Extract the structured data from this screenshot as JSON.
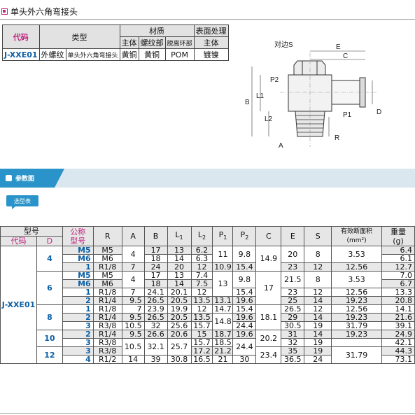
{
  "title": "单头外六角弯接头",
  "product_table": {
    "headers": {
      "code": "代码",
      "type": "类型",
      "material": "材质",
      "surface": "表面处理",
      "body": "主体",
      "thread": "螺纹部",
      "release": "脱离环部",
      "surface_body": "主体"
    },
    "row": {
      "code": "J-XXE01",
      "type1": "外螺纹",
      "type2": "单头外六角弯接头",
      "body": "黄铜",
      "thread": "黄铜",
      "release": "POM",
      "surface": "镀镍"
    }
  },
  "diagram": {
    "hex_label": "对边S",
    "labels": [
      "E",
      "C",
      "P2",
      "L1",
      "B",
      "L2",
      "P1",
      "D",
      "A",
      "R"
    ]
  },
  "section_tab": "参数图",
  "select_button": "选型表",
  "param_table": {
    "headers": {
      "model": "型号",
      "code": "代码",
      "d": "D",
      "nominal_1": "公称",
      "nominal_2": "型号",
      "r": "R",
      "a": "A",
      "b": "B",
      "l1": "L",
      "l1_sub": "1",
      "l2": "L",
      "l2_sub": "2",
      "p1": "P",
      "p1_sub": "1",
      "p2": "P",
      "p2_sub": "2",
      "c": "C",
      "e": "E",
      "s": "S",
      "area_1": "有效断面积",
      "area_2": "(mm²)",
      "weight_1": "重量",
      "weight_2": "(g)"
    },
    "code": "J-XXE01",
    "d_values": [
      "4",
      "6",
      "8",
      "10",
      "12"
    ],
    "rows": [
      {
        "nom": "M5",
        "r": "M5",
        "a": "4",
        "b": "17",
        "l1": "13",
        "l2": "6.2",
        "p1": "11",
        "p2": "9.8",
        "c": "14.9",
        "e": "20",
        "s": "8",
        "area": "3.53",
        "w": "6.4"
      },
      {
        "nom": "M6",
        "r": "M6",
        "b": "18",
        "l1": "14",
        "l2": "6.3",
        "w": "6.1"
      },
      {
        "nom": "1",
        "r": "R1/8",
        "a": "7",
        "b": "24",
        "l1": "20",
        "l2": "12",
        "p1": "10.9",
        "p2": "15.4",
        "e": "23",
        "s": "12",
        "area": "12.56",
        "w": "12.7"
      },
      {
        "nom": "M5",
        "r": "M5",
        "a": "4",
        "b": "17",
        "l1": "13",
        "l2": "7.4",
        "p1": "13",
        "p2": "9.8",
        "c": "17",
        "e": "21.5",
        "s": "8",
        "area": "3.53",
        "w": "7.0"
      },
      {
        "nom": "M6",
        "r": "M6",
        "b": "18",
        "l1": "14",
        "l2": "7.5",
        "w": "6.7"
      },
      {
        "nom": "1",
        "r": "R1/8",
        "a": "7",
        "b": "24.1",
        "l1": "20.1",
        "l2": "12",
        "p2": "15.4",
        "e": "23",
        "s": "12",
        "area": "12.56",
        "w": "13.3"
      },
      {
        "nom": "2",
        "r": "R1/4",
        "a": "9.5",
        "b": "26.5",
        "l1": "20.5",
        "l2": "13.5",
        "p1": "13.1",
        "p2": "19.6",
        "e": "25",
        "s": "14",
        "area": "19.23",
        "w": "20.8"
      },
      {
        "nom": "1",
        "r": "R1/8",
        "a": "7",
        "b": "23.9",
        "l1": "19.9",
        "l2": "12",
        "p1": "14.7",
        "p2": "15.4",
        "c": "18.1",
        "e": "26.5",
        "s": "12",
        "area": "12.56",
        "w": "14.1"
      },
      {
        "nom": "2",
        "r": "R1/4",
        "a": "9.5",
        "b": "26.5",
        "l1": "20.5",
        "l2": "13.5",
        "p1": "14.8",
        "p2": "19.6",
        "e": "29",
        "s": "14",
        "area": "19.23",
        "w": "21.6"
      },
      {
        "nom": "3",
        "r": "R3/8",
        "a": "10.5",
        "b": "32",
        "l1": "25.6",
        "l2": "15.7",
        "p2": "24.4",
        "e": "30.5",
        "s": "19",
        "area": "31.79",
        "w": "39.1"
      },
      {
        "nom": "2",
        "r": "R1/4",
        "a": "9.5",
        "b": "26.6",
        "l1": "20.6",
        "l2": "15",
        "p1": "18.7",
        "p2": "19.6",
        "c": "20.2",
        "e": "31",
        "s": "14",
        "area": "19.23",
        "w": "24.9"
      },
      {
        "nom": "3",
        "r": "R3/8",
        "a": "10.5",
        "b": "32.1",
        "l1": "25.7",
        "l2": "15.7",
        "p1": "18.5",
        "p2": "24.4",
        "e": "32",
        "s": "19",
        "w": "42.1"
      },
      {
        "nom": "3",
        "r": "R3/8",
        "l2": "17.2",
        "p1": "21.2",
        "c": "23.4",
        "e": "35",
        "s": "19",
        "area": "31.79",
        "w": "44.3"
      },
      {
        "nom": "4",
        "r": "R1/2",
        "a": "14",
        "b": "39",
        "l1": "30.8",
        "l2": "16.5",
        "p1": "21",
        "p2": "30",
        "e": "36.5",
        "s": "24",
        "w": "73.1"
      }
    ]
  }
}
